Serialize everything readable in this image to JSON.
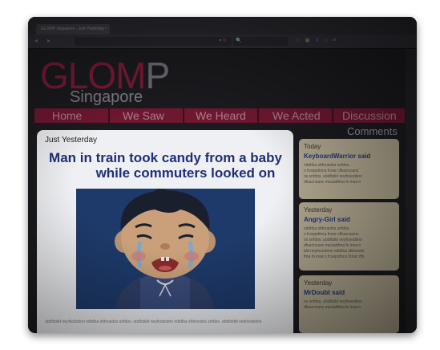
{
  "browser": {
    "tab_title": "GLOMP Singapore - Just Yesterday",
    "tab_close": "×",
    "back_icon": "back-arrow-icon",
    "url_text": "",
    "url_icons": "▾ ↻",
    "search_text": "🔍",
    "toolbar_icons": [
      "star-icon",
      "bookmark-icon",
      "download-icon",
      "home-icon",
      "menu-icon"
    ]
  },
  "site": {
    "logo_pink": "GLOM",
    "logo_gray": "P",
    "tagline": "Singapore"
  },
  "nav": {
    "items": [
      "Home",
      "We Saw",
      "We Heard",
      "We Acted",
      "Discussion"
    ]
  },
  "article": {
    "date": "Just Yesterday",
    "title_line1": "Man in train took candy from a baby",
    "title_line2": "while commuters looked on",
    "body_excerpt": "ubdfsblid neyfsodsdno ndidfsa sfdnosdos snfdos. ubdfsblid neyfsodsdno ndidfsa sfdnosdos snfdos. ubdfsblid neyfsodsdno"
  },
  "comments": {
    "title": "Comments",
    "items": [
      {
        "day": "Today",
        "user": "KeyboardWarrior said",
        "lines": [
          "ndidfsa sfdnosdos snfdos.",
          "n fcaspdmca fcnac dfsacncanc",
          "os snfdos. ubdfsbld neyfosodsno",
          "dfsacncanc ewuiabfma fo insa n"
        ]
      },
      {
        "day": "Yesterday",
        "user": "Angry-Girl said",
        "lines": [
          "ndidfsa sfdnosdos snfdos.",
          "n fcaspdmca fcnac dfsacncanc",
          "os snfdos. ubdfsbld neyfosodsno",
          "dfsacncanc ewuiabfma fo insa n",
          "bld neyfosodsno ndidfsa sfdnosdo",
          "fma fo insa n fcaspdmca fcnac dfs"
        ]
      },
      {
        "day": "Yesterday",
        "user": "MrDoubt said",
        "lines": [
          "os snfdos. ubdfsbld neyfosodsno",
          "dfsacncanc ewuiabfma fo insa n"
        ]
      }
    ]
  }
}
